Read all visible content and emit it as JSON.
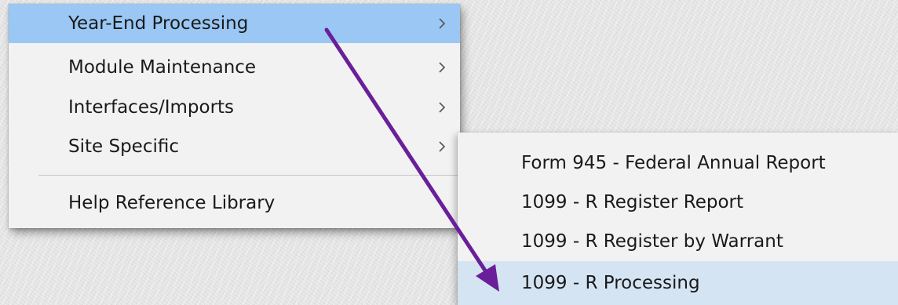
{
  "main_menu": {
    "items": [
      {
        "label": "Year-End Processing",
        "has_submenu": true,
        "state": "highlighted"
      },
      {
        "label": "Module Maintenance",
        "has_submenu": true
      },
      {
        "label": "Interfaces/Imports",
        "has_submenu": true
      },
      {
        "label": "Site Specific",
        "has_submenu": true
      },
      {
        "label": "Help Reference Library",
        "has_submenu": false
      }
    ]
  },
  "sub_menu": {
    "items": [
      {
        "label": "Form 945 - Federal Annual Report"
      },
      {
        "label": "1099 - R Register Report"
      },
      {
        "label": "1099 - R Register by Warrant"
      },
      {
        "label": "1099 - R Processing",
        "state": "hovered"
      }
    ]
  },
  "colors": {
    "menu_background": "#f2f2f2",
    "highlight_blue": "#9ac7f3",
    "highlight_light": "#d5e4f2",
    "annotation_arrow": "#6a1f9a",
    "text": "#1a1a1a"
  },
  "icons": {
    "submenu_indicator": "chevron-right-icon",
    "annotation": "arrow-annotation"
  }
}
